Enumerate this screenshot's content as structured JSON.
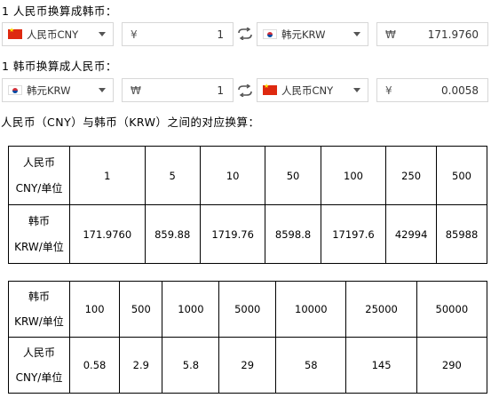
{
  "section1": {
    "title": "1 人民币换算成韩币：",
    "from_select": "人民币CNY",
    "from_input_currency": "¥",
    "from_input_value": "1",
    "to_select": "韩元KRW",
    "to_input_currency": "₩",
    "to_input_value": "171.9760"
  },
  "section2": {
    "title": "1 韩币换算成人民币：",
    "from_select": "韩元KRW",
    "from_input_currency": "₩",
    "from_input_value": "1",
    "to_select": "人民币CNY",
    "to_input_currency": "¥",
    "to_input_value": "0.0058"
  },
  "table_heading": "人民币（CNY）与韩币（KRW）之间的对应换算：",
  "table1": {
    "row1": {
      "label_top": "人民币",
      "label_bottom": "CNY/单位",
      "values": [
        "1",
        "5",
        "10",
        "50",
        "100",
        "250",
        "500"
      ]
    },
    "row2": {
      "label_top": "韩币",
      "label_bottom": "KRW/单位",
      "values": [
        "171.9760",
        "859.88",
        "1719.76",
        "8598.8",
        "17197.6",
        "42994",
        "85988"
      ]
    }
  },
  "table2": {
    "row1": {
      "label_top": "韩币",
      "label_bottom": "KRW/单位",
      "values": [
        "100",
        "500",
        "1000",
        "5000",
        "10000",
        "25000",
        "50000"
      ]
    },
    "row2": {
      "label_top": "人民币",
      "label_bottom": "CNY/单位",
      "values": [
        "0.58",
        "2.9",
        "5.8",
        "29",
        "58",
        "145",
        "290"
      ]
    }
  },
  "icons": {
    "swap": "swap-arrows-icon",
    "cny_flag": "china-flag-icon",
    "krw_flag": "korea-flag-icon",
    "dropdown": "chevron-down-icon"
  }
}
